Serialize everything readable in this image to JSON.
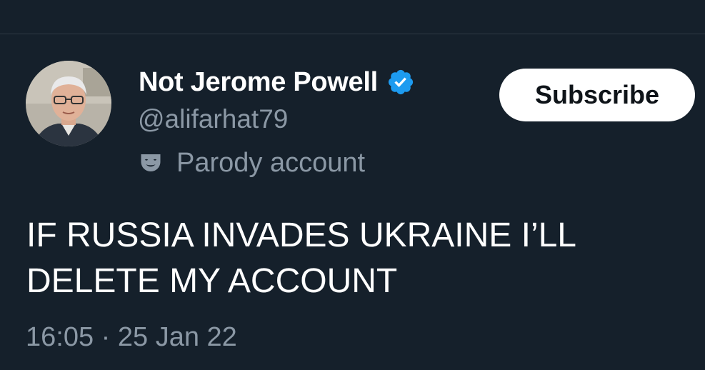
{
  "tweet": {
    "author": {
      "name": "Not Jerome Powell",
      "handle": "@alifarhat79",
      "verified": true,
      "verified_color": "#1d9bf0",
      "parody_label": "Parody account",
      "parody_icon": "theater-mask-icon"
    },
    "subscribe_label": "Subscribe",
    "text_lines": [
      "IF RUSSIA INVADES UKRAINE I’LL",
      "DELETE MY ACCOUNT"
    ],
    "time": "16:05",
    "separator": "·",
    "date": "25 Jan 22"
  },
  "colors": {
    "background": "#15202b",
    "primary_text": "#ffffff",
    "secondary_text": "#8b98a5",
    "button_bg": "#ffffff",
    "button_text": "#0f1419"
  }
}
